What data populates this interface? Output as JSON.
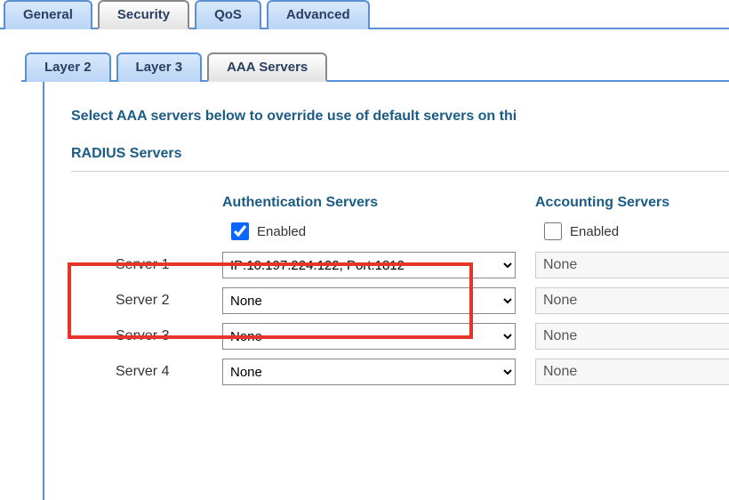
{
  "top_tabs": {
    "general": "General",
    "security": "Security",
    "qos": "QoS",
    "advanced": "Advanced"
  },
  "sub_tabs": {
    "layer2": "Layer 2",
    "layer3": "Layer 3",
    "aaa": "AAA Servers"
  },
  "instruction": "Select AAA servers below to override use of default servers on thi",
  "radius_section": "RADIUS Servers",
  "auth_col": "Authentication Servers",
  "acct_col": "Accounting Servers",
  "enabled_label": "Enabled",
  "servers": {
    "s1": {
      "label": "Server 1",
      "auth_value": "IP:10.197.224.122, Port:1812",
      "acct_value": "None"
    },
    "s2": {
      "label": "Server 2",
      "auth_value": "None",
      "acct_value": "None"
    },
    "s3": {
      "label": "Server 3",
      "auth_value": "None",
      "acct_value": "None"
    },
    "s4": {
      "label": "Server 4",
      "auth_value": "None",
      "acct_value": "None"
    }
  },
  "auth_enabled": true,
  "acct_enabled": false
}
